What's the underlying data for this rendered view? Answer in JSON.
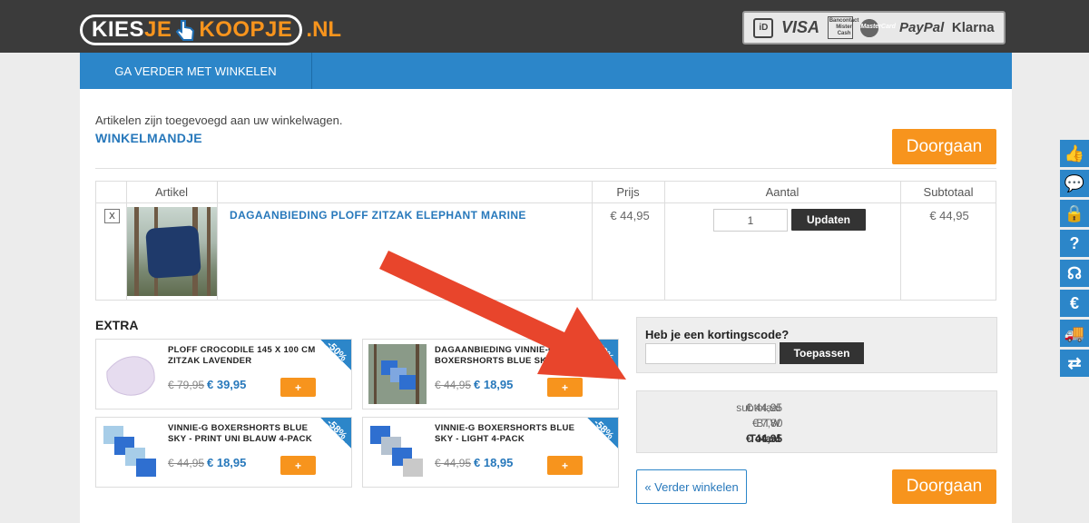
{
  "logo": {
    "part1": "KIES",
    "part2": "JE",
    "part3": "KOOPJE",
    "tld": ".NL"
  },
  "payments": {
    "ideal": "iD",
    "visa": "VISA",
    "bancontact": "Bancontact Mister Cash",
    "mastercard": "MasterCard",
    "paypal": "PayPal",
    "klarna": "Klarna"
  },
  "nav": {
    "continue_shopping": "GA VERDER MET WINKELEN"
  },
  "cart": {
    "added_message": "Artikelen zijn toegevoegd aan uw winkelwagen.",
    "title": "WINKELMANDJE",
    "checkout_label": "Doorgaan",
    "headers": {
      "article": "Artikel",
      "price": "Prijs",
      "quantity": "Aantal",
      "subtotal": "Subtotaal"
    },
    "remove_label": "X",
    "item": {
      "name": "DAGAANBIEDING PLOFF ZITZAK ELEPHANT MARINE",
      "price": "€ 44,95",
      "quantity": "1",
      "subtotal": "€ 44,95"
    },
    "update_label": "Updaten"
  },
  "extra": {
    "title": "EXTRA",
    "add_label": "+",
    "items": [
      {
        "name": "PLOFF CROCODILE 145 X 100 CM ZITZAK LAVENDER",
        "old_price": "€ 79,95",
        "new_price": "€ 39,95",
        "discount": "-50%"
      },
      {
        "name": "DAGAANBIEDING VINNIE-G BOXERSHORTS BLUE SKY - LIGHT",
        "old_price": "€ 44,95",
        "new_price": "€ 18,95",
        "discount": "-58%"
      },
      {
        "name": "VINNIE-G BOXERSHORTS BLUE SKY - PRINT UNI BLAUW 4-PACK",
        "old_price": "€ 44,95",
        "new_price": "€ 18,95",
        "discount": "-58%"
      },
      {
        "name": "VINNIE-G BOXERSHORTS BLUE SKY - LIGHT 4-PACK",
        "old_price": "€ 44,95",
        "new_price": "€ 18,95",
        "discount": "-58%"
      }
    ]
  },
  "coupon": {
    "label": "Heb je een kortingscode?",
    "value": "",
    "apply_label": "Toepassen"
  },
  "totals": {
    "subtotal_label": "subtotaal",
    "subtotal_value": "€ 44,95",
    "vat_label": "BTW",
    "vat_value": "€ 7,80",
    "total_label": "Totaal",
    "total_value": "€ 44,95"
  },
  "back_label": "« Verder winkelen",
  "side_tabs": [
    {
      "icon": "thumbs-up-icon",
      "glyph": "👍"
    },
    {
      "icon": "chat-icon",
      "glyph": "💬"
    },
    {
      "icon": "lock-icon",
      "glyph": "🔒"
    },
    {
      "icon": "question-icon",
      "glyph": "?"
    },
    {
      "icon": "headset-icon",
      "glyph": "☊"
    },
    {
      "icon": "euro-icon",
      "glyph": "€"
    },
    {
      "icon": "truck-icon",
      "glyph": "🚚"
    },
    {
      "icon": "return-icon",
      "glyph": "⇄"
    }
  ],
  "colors": {
    "brand_blue": "#2c86c9",
    "accent_orange": "#f7941d",
    "annotation_arrow": "#e8452c"
  }
}
